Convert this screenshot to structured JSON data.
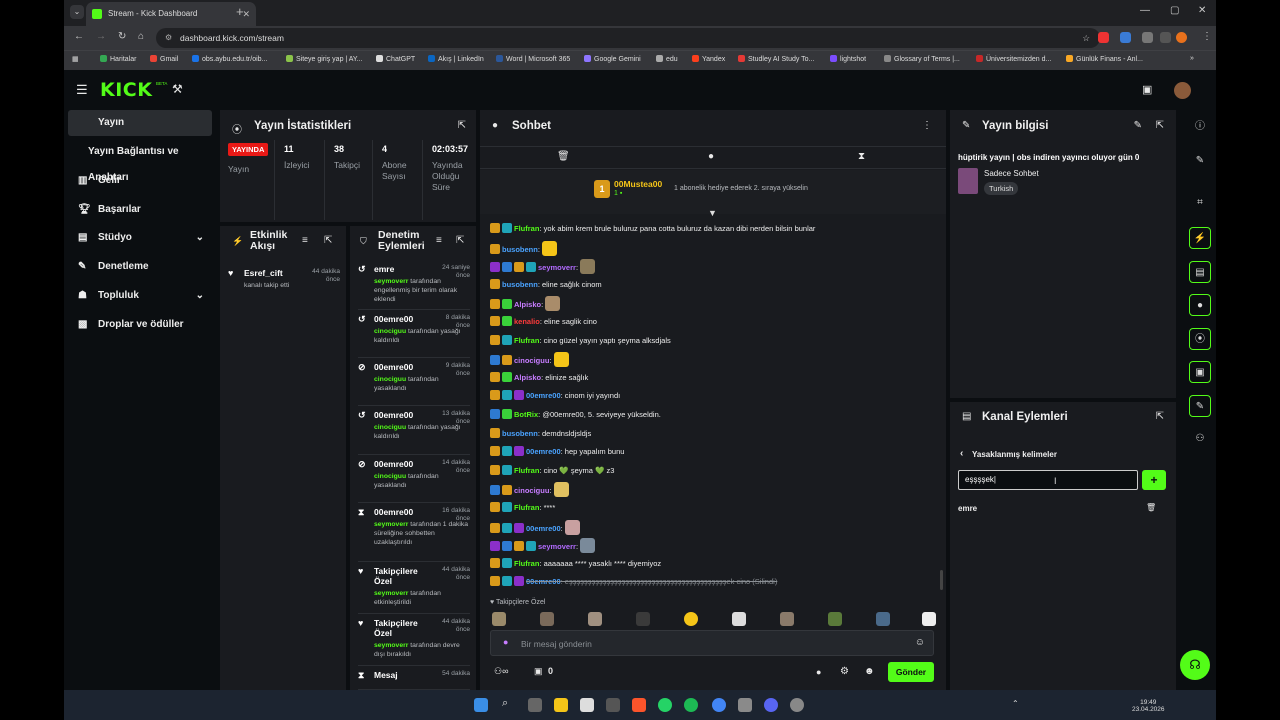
{
  "browser": {
    "tab_title": "Stream - Kick Dashboard",
    "url": "dashboard.kick.com/stream",
    "bookmarks": [
      "Haritalar",
      "Gmail",
      "obs.aybu.edu.tr/oib...",
      "Siteye giriş yap | AY...",
      "ChatGPT",
      "Akış | LinkedIn",
      "Word | Microsoft 365",
      "Google Gemini",
      "edu",
      "Yandex",
      "Studley AI Study To...",
      "lightshot",
      "Glossary of Terms |...",
      "Üniversitemizden d...",
      "Günlük Finans - Anl..."
    ]
  },
  "header": {
    "logo": "KICK",
    "beta": "BETA"
  },
  "nav": {
    "items": [
      {
        "label": "Yayın",
        "icon": "broadcast-icon"
      },
      {
        "label": "Yayın Bağlantısı ve Anahtarı",
        "icon": ""
      },
      {
        "label": "Gelir",
        "icon": "revenue-icon"
      },
      {
        "label": "Başarılar",
        "icon": "trophy-icon"
      },
      {
        "label": "Stüdyo",
        "icon": "studio-icon"
      },
      {
        "label": "Denetleme",
        "icon": "wrench-icon"
      },
      {
        "label": "Topluluk",
        "icon": "community-icon"
      },
      {
        "label": "Droplar ve ödüller",
        "icon": "gift-icon"
      }
    ]
  },
  "stats": {
    "title": "Yayın İstatistikleri",
    "live_badge": "YAYINDA",
    "live_label": "Yayın",
    "viewers": "11",
    "viewers_label": "İzleyici",
    "followers": "38",
    "followers_label": "Takipçi",
    "subs": "4",
    "subs_label": "Abone Sayısı",
    "duration": "02:03:57",
    "duration_label": "Yayında Olduğu Süre"
  },
  "activity": {
    "title": "Etkinlik Akışı",
    "items": [
      {
        "user": "Esref_cift",
        "time": "44 dakika önce",
        "desc": "kanalı takip etti"
      }
    ]
  },
  "modlog": {
    "title": "Denetim Eylemleri",
    "items": [
      {
        "user": "emre",
        "time": "24 saniye önce",
        "actor": "seymoverr",
        "desc": " tarafından engellenmiş bir terim olarak eklendi",
        "icon": "undo-icon"
      },
      {
        "user": "00emre00",
        "time": "8 dakika önce",
        "actor": "cinociguu",
        "desc": " tarafından yasağı kaldırıldı",
        "icon": "undo-icon"
      },
      {
        "user": "00emre00",
        "time": "9 dakika önce",
        "actor": "cinociguu",
        "desc": " tarafından yasaklandı",
        "icon": "ban-icon"
      },
      {
        "user": "00emre00",
        "time": "13 dakika önce",
        "actor": "cinociguu",
        "desc": " tarafından yasağı kaldırıldı",
        "icon": "undo-icon"
      },
      {
        "user": "00emre00",
        "time": "14 dakika önce",
        "actor": "cinociguu",
        "desc": " tarafından yasaklandı",
        "icon": "ban-icon"
      },
      {
        "user": "00emre00",
        "time": "16 dakika önce",
        "actor": "seymoverr",
        "desc": " tarafından 1 dakika süreliğine sohbetten uzaklaştırıldı",
        "icon": "hourglass-icon"
      },
      {
        "user": "Takipçilere Özel",
        "time": "44 dakika önce",
        "actor": "seymoverr",
        "desc": " tarafından etkinleştirildi",
        "icon": "heart-icon"
      },
      {
        "user": "Takipçilere Özel",
        "time": "44 dakika önce",
        "actor": "seymoverr",
        "desc": " tarafından devre dışı bırakıldı",
        "icon": "heart-icon"
      },
      {
        "user": "Mesaj",
        "time": "54 dakika",
        "actor": "",
        "desc": "",
        "icon": "hourglass-icon"
      }
    ]
  },
  "chat": {
    "title": "Sohbet",
    "pinned_user": "00Mustea00",
    "pinned_rank": "1",
    "pinned_text": "1 abonelik hediye ederek 2. sıraya yükselin",
    "messages": [
      {
        "user": "Flufran",
        "color": "#53fc18",
        "text": ": yok abim krem brule buluruz pana cotta buluruz da kazan dibi nerden bilsin bunlar",
        "badges": [
          "crown",
          "sub"
        ],
        "emote": ""
      },
      {
        "user": "busobenn",
        "color": "#4aa3ff",
        "text": ":",
        "badges": [
          "crown"
        ],
        "emote": "#f5c518"
      },
      {
        "user": "seymoverr",
        "color": "#b26bff",
        "text": ":",
        "badges": [
          "pur",
          "vip",
          "crown",
          "sub"
        ],
        "emote": "#8a7a5a"
      },
      {
        "user": "busobenn",
        "color": "#4aa3ff",
        "text": ": eline sağlık cinom",
        "badges": [
          "crown"
        ],
        "emote": ""
      },
      {
        "user": "Alpisko",
        "color": "#c77dff",
        "text": ":",
        "badges": [
          "crown",
          "grn"
        ],
        "emote": "#a98c6a"
      },
      {
        "user": "kenalio",
        "color": "#ff3b3b",
        "text": ": eline saglik cino",
        "badges": [
          "crown",
          "grn"
        ],
        "emote": ""
      },
      {
        "user": "Flufran",
        "color": "#53fc18",
        "text": ": cino güzel yayın yaptı şeyma alksdjals",
        "badges": [
          "crown",
          "sub"
        ],
        "emote": ""
      },
      {
        "user": "cinociguu",
        "color": "#c77dff",
        "text": ":",
        "badges": [
          "vip",
          "crown"
        ],
        "emote": "#f5c518"
      },
      {
        "user": "Alpisko",
        "color": "#c77dff",
        "text": ": elinize sağlık",
        "badges": [
          "crown",
          "grn"
        ],
        "emote": ""
      },
      {
        "user": "00emre00",
        "color": "#4aa3ff",
        "text": ": cinom iyi yayındı",
        "badges": [
          "crown",
          "sub",
          "pur"
        ],
        "emote": ""
      },
      {
        "user": "BotRix",
        "color": "#53fc18",
        "text": ": @00emre00, 5. seviyeye yükseldin.",
        "badges": [
          "vip",
          "grn"
        ],
        "emote": ""
      },
      {
        "user": "busobenn",
        "color": "#4aa3ff",
        "text": ": demdnsldjsldjs",
        "badges": [
          "crown"
        ],
        "emote": ""
      },
      {
        "user": "00emre00",
        "color": "#4aa3ff",
        "text": ": hep yapalım bunu",
        "badges": [
          "crown",
          "sub",
          "pur"
        ],
        "emote": ""
      },
      {
        "user": "Flufran",
        "color": "#53fc18",
        "text": ": cino 💚 şeyma 💚 z3",
        "badges": [
          "crown",
          "sub"
        ],
        "emote": ""
      },
      {
        "user": "cinociguu",
        "color": "#c77dff",
        "text": ":",
        "badges": [
          "vip",
          "crown"
        ],
        "emote": "#e0c060"
      },
      {
        "user": "Flufran",
        "color": "#53fc18",
        "text": ": ****",
        "badges": [
          "crown",
          "sub"
        ],
        "emote": ""
      },
      {
        "user": "00emre00",
        "color": "#4aa3ff",
        "text": ":",
        "badges": [
          "crown",
          "sub",
          "pur"
        ],
        "emote": "#c8a0a0"
      },
      {
        "user": "seymoverr",
        "color": "#b26bff",
        "text": ":",
        "badges": [
          "pur",
          "vip",
          "crown",
          "sub"
        ],
        "emote": "#7a8a9a"
      },
      {
        "user": "Flufran",
        "color": "#53fc18",
        "text": ": aaaaaaa **** yasaklı **** diyemiyoz",
        "badges": [
          "crown",
          "sub"
        ],
        "emote": ""
      },
      {
        "user": "00emre00",
        "color": "#4aa3ff",
        "text": ": eşşşşşşşşşşşşşşşşşşşşşşşşşşşşşşşşşşşşşşşşşşek cino (Silindi)",
        "badges": [
          "crown",
          "sub",
          "pur"
        ],
        "emote": ""
      }
    ],
    "followers_only": "Takipçilere Özel",
    "input_placeholder": "Bir mesaj gönderin",
    "count": "0",
    "send_label": "Gönder"
  },
  "stream_info": {
    "title": "Yayın bilgisi",
    "stream_title": "hüptirik yayın | obs indiren yayıncı oluyor gün 0",
    "category": "Sadece Sohbet",
    "language": "Turkish"
  },
  "channel_actions": {
    "title": "Kanal Eylemleri",
    "back_label": "Yasaklanmış kelimeler",
    "input_value": "eşşşşek",
    "word": "emre"
  },
  "taskbar": {
    "time": "19:49",
    "date": "23.04.2026"
  },
  "colors": {
    "accent": "#53fc18",
    "panel": "#191b1f",
    "bg": "#0b0e11"
  }
}
